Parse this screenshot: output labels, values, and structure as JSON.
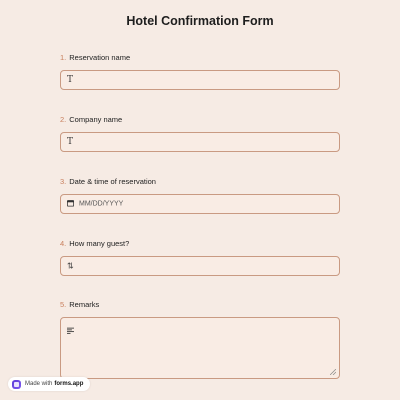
{
  "page_title": "Hotel Confirmation Form",
  "questions": [
    {
      "number": "1.",
      "label": "Reservation name",
      "icon": "text-icon"
    },
    {
      "number": "2.",
      "label": "Company name",
      "icon": "text-icon"
    },
    {
      "number": "3.",
      "label": "Date & time of reservation",
      "icon": "calendar-icon",
      "placeholder": "MM/DD/YYYY"
    },
    {
      "number": "4.",
      "label": "How many guest?",
      "icon": "sort-number-icon"
    },
    {
      "number": "5.",
      "label": "Remarks",
      "icon": "list-lines-icon"
    }
  ],
  "glyphs": {
    "text": "T",
    "number": "⇅"
  },
  "footer": {
    "made_with": "Made with",
    "brand": "forms.app"
  },
  "colors": {
    "background": "#f6ebe4",
    "number_accent": "#c87f5d",
    "field_border": "#c99a82",
    "brand": "#5b3bd6"
  }
}
